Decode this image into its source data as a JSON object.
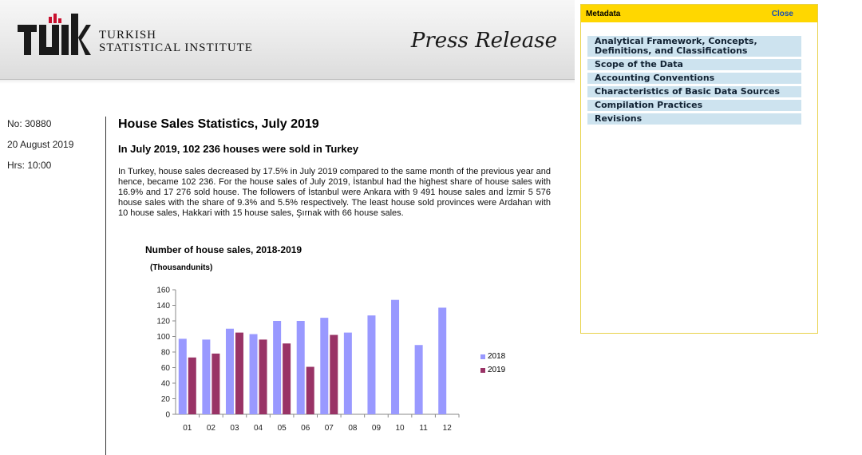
{
  "header": {
    "logo_line1": "TURKISH",
    "logo_line2": "STATISTICAL INSTITUTE",
    "press_release": "Press Release"
  },
  "meta_left": {
    "number": "No: 30880",
    "date": "20 August 2019",
    "time": "Hrs: 10:00"
  },
  "content": {
    "title": "House Sales Statistics, July 2019",
    "subtitle": "In July 2019, 102 236 houses were sold in Turkey",
    "body": "In Turkey, house sales decreased by 17.5% in July 2019 compared to the same month of the previous year and hence, became 102 236. For the house sales of July 2019, İstanbul had the highest share of house sales with 16.9% and 17 276 sold house. The followers of İstanbul were Ankara with 9 491 house sales and İzmir 5 576 house sales with the share of 9.3% and 5.5% respectively. The least house sold provinces were Ardahan with 10 house sales, Hakkari with 15 house sales, Şırnak with 66 house sales."
  },
  "colors": {
    "series_2018": "#9999ff",
    "series_2019": "#993366",
    "panel_header": "#ffd700",
    "panel_item_bg": "#cde3ef"
  },
  "chart_data": {
    "type": "bar",
    "title": "Number of house sales, 2018-2019",
    "units": "(Thousandunits)",
    "categories": [
      "01",
      "02",
      "03",
      "04",
      "05",
      "06",
      "07",
      "08",
      "09",
      "10",
      "11",
      "12"
    ],
    "ylim": [
      0,
      160
    ],
    "yticks": [
      0,
      20,
      40,
      60,
      80,
      100,
      120,
      140,
      160
    ],
    "series": [
      {
        "name": "2018",
        "values": [
          97,
          96,
          110,
          103,
          120,
          120,
          124,
          105,
          127,
          147,
          89,
          137
        ]
      },
      {
        "name": "2019",
        "values": [
          73,
          78,
          105,
          96,
          91,
          61,
          102,
          null,
          null,
          null,
          null,
          null
        ]
      }
    ],
    "legend_position": "right"
  },
  "metadata_panel": {
    "title": "Metadata",
    "close_label": "Close",
    "items": [
      "Analytical Framework, Concepts, Definitions, and Classifications",
      "Scope of the Data",
      "Accounting Conventions",
      "Characteristics of Basic Data Sources",
      "Compilation Practices",
      "Revisions"
    ]
  }
}
